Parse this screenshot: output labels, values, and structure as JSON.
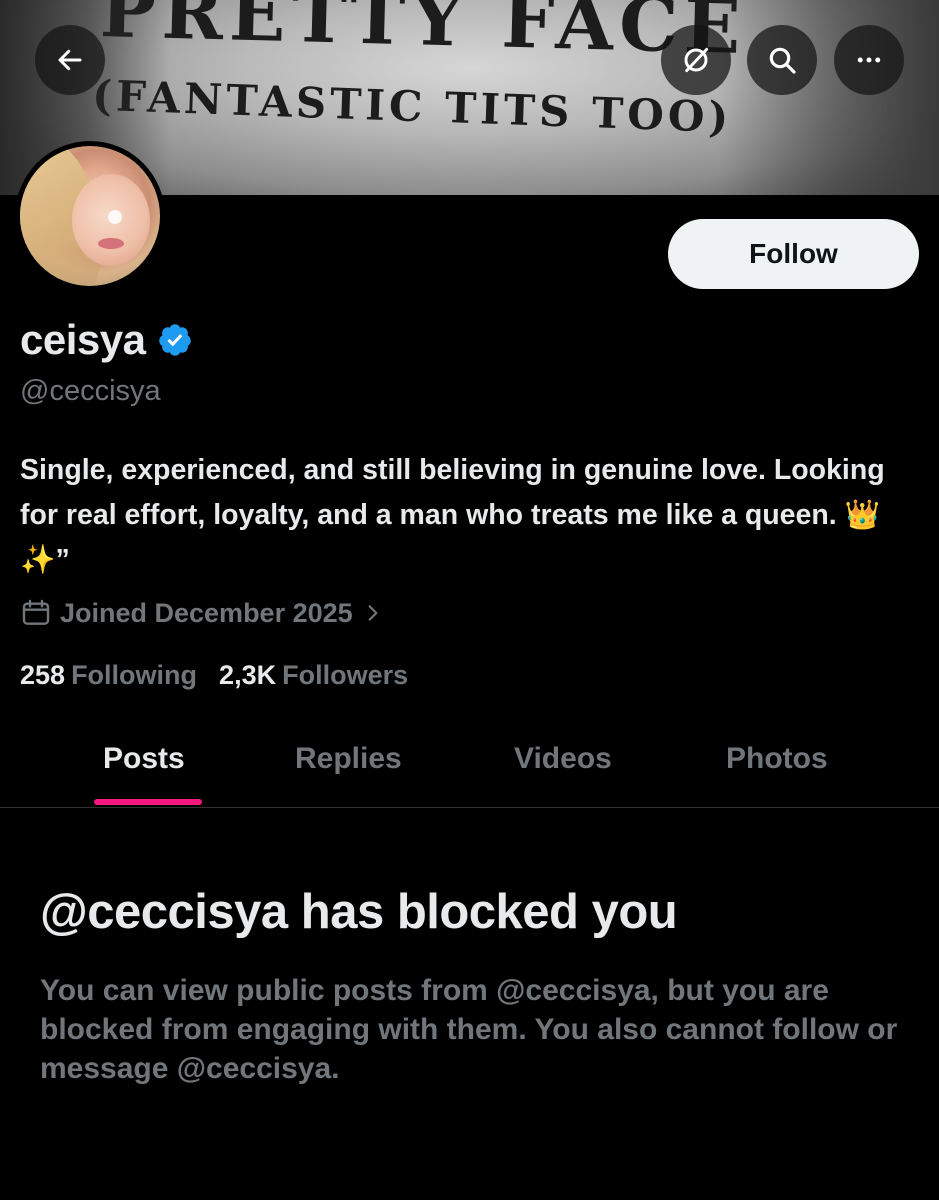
{
  "banner": {
    "line1": "PRETTY FACE",
    "line2": "(FANTASTIC TITS TOO)"
  },
  "top_bar": {
    "icons": [
      "back-arrow-icon",
      "grok-icon",
      "search-icon",
      "more-icon"
    ]
  },
  "profile": {
    "display_name": "ceisya",
    "verified": true,
    "handle": "@ceccisya",
    "follow_label": "Follow",
    "bio": "Single, experienced, and still believing in genuine love. Looking for real effort, loyalty, and a man who treats me like a queen. 👑 ✨”",
    "joined": "Joined December 2025",
    "following_count": "258",
    "following_label": "Following",
    "followers_count": "2,3K",
    "followers_label": "Followers"
  },
  "tabs": [
    {
      "label": "Posts",
      "active": true
    },
    {
      "label": "Replies",
      "active": false
    },
    {
      "label": "Videos",
      "active": false
    },
    {
      "label": "Photos",
      "active": false
    }
  ],
  "blocked": {
    "title": "@ceccisya has blocked you",
    "body": "You can view public posts from @ceccisya, but you are blocked from engaging with them. You also cannot follow or message @ceccisya."
  },
  "colors": {
    "background": "#000000",
    "text_primary": "#e7e9ea",
    "text_secondary": "#71767b",
    "verified_blue": "#1d9bf0",
    "tab_indicator": "#f91880",
    "follow_button_bg": "#eff3f4"
  }
}
